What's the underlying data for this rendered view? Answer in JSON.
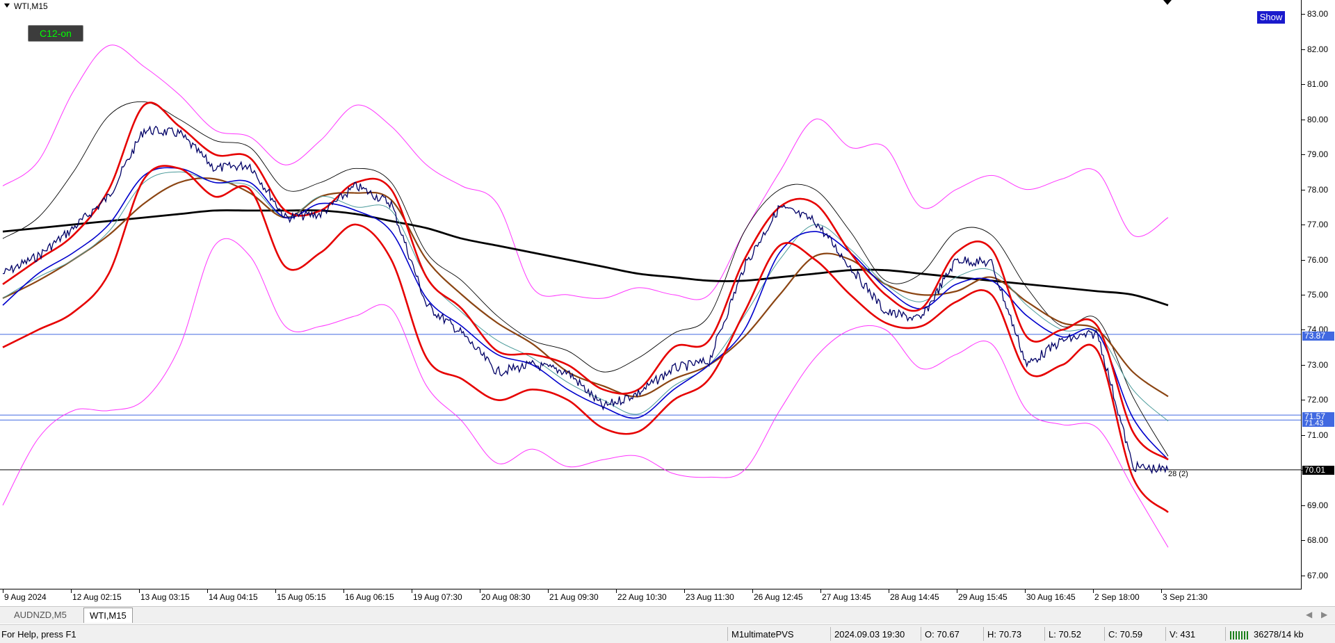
{
  "chart": {
    "title": "WTI,M15",
    "c12_button": "C12-on",
    "show_button": "Show",
    "colors": {
      "background": "#ffffff",
      "price_line": "#000066",
      "band_red": "#e60000",
      "ma_blue": "#0000cc",
      "ma_teal": "#4a9a9a",
      "ma_brown": "#8b4513",
      "ma_black": "#000000",
      "envelope_magenta": "#ff33ff",
      "bollinger_black": "#000000",
      "hline_blue": "#4169e1"
    },
    "level_labels": {
      "l1": "73.87",
      "l2": "71.57",
      "l3": "71.43",
      "current": "70.01"
    },
    "annotation": "28 (2)"
  },
  "chart_data": {
    "type": "line",
    "symbol": "WTI",
    "timeframe": "M15",
    "ylim": [
      66.6,
      83.4
    ],
    "y_ticks": [
      "67.00",
      "68.00",
      "69.00",
      "70.00",
      "71.00",
      "72.00",
      "73.00",
      "74.00",
      "75.00",
      "76.00",
      "77.00",
      "78.00",
      "79.00",
      "80.00",
      "81.00",
      "82.00",
      "83.00"
    ],
    "x_ticks": [
      "9 Aug 2024",
      "12 Aug 02:15",
      "13 Aug 03:15",
      "14 Aug 04:15",
      "15 Aug 05:15",
      "16 Aug 06:15",
      "19 Aug 07:30",
      "20 Aug 08:30",
      "21 Aug 09:30",
      "22 Aug 10:30",
      "23 Aug 11:30",
      "26 Aug 12:45",
      "27 Aug 13:45",
      "28 Aug 14:45",
      "29 Aug 15:45",
      "30 Aug 16:45",
      "2 Sep 18:00",
      "3 Sep 21:30"
    ],
    "horizontal_levels": [
      73.87,
      71.57,
      71.43,
      70.01
    ],
    "series": [
      {
        "values": [
          75.6,
          76.1,
          76.9,
          77.8,
          79.7,
          79.6,
          78.6,
          78.7,
          77.2,
          77.3,
          78.1,
          77.6,
          74.7,
          73.9,
          72.8,
          73.0,
          72.8,
          71.8,
          72.2,
          72.9,
          73.1,
          75.8,
          77.5,
          77.1,
          75.8,
          74.5,
          74.3,
          76.0,
          75.9,
          73.0,
          73.7,
          73.9,
          70.1,
          70.0
        ]
      },
      {
        "values": [
          75.3,
          76.0,
          76.7,
          78.0,
          80.4,
          79.8,
          79.0,
          78.9,
          77.4,
          77.4,
          78.2,
          78.0,
          75.5,
          74.6,
          73.4,
          73.3,
          73.0,
          72.3,
          72.3,
          73.5,
          73.7,
          76.0,
          77.5,
          77.6,
          76.2,
          75.0,
          74.6,
          76.2,
          76.3,
          73.8,
          74.0,
          74.1,
          71.1,
          70.3
        ]
      },
      {
        "values": [
          74.7,
          75.6,
          76.2,
          77.0,
          78.4,
          78.6,
          78.2,
          78.2,
          77.2,
          77.6,
          77.4,
          76.8,
          74.9,
          74.1,
          73.3,
          73.0,
          72.3,
          71.8,
          71.5,
          72.3,
          73.0,
          74.0,
          76.2,
          76.8,
          76.2,
          75.2,
          74.6,
          75.3,
          75.4,
          74.4,
          73.8,
          73.9,
          71.5,
          70.3
        ]
      },
      {
        "values": [
          74.9,
          75.5,
          76.0,
          76.8,
          78.2,
          78.5,
          78.2,
          78.1,
          77.2,
          77.8,
          77.5,
          77.4,
          75.5,
          74.5,
          73.7,
          73.2,
          72.5,
          72.0,
          71.6,
          72.4,
          73.0,
          74.4,
          76.0,
          77.0,
          76.3,
          75.3,
          74.8,
          75.5,
          75.7,
          74.7,
          74.0,
          73.9,
          72.3,
          71.4
        ]
      },
      {
        "values": [
          74.9,
          75.4,
          76.0,
          76.7,
          77.6,
          78.2,
          78.3,
          77.9,
          77.2,
          77.8,
          77.9,
          77.7,
          76.0,
          75.0,
          74.2,
          73.6,
          72.8,
          72.4,
          72.1,
          72.6,
          73.0,
          73.8,
          75.0,
          76.1,
          76.0,
          75.3,
          75.0,
          75.1,
          75.5,
          74.8,
          74.2,
          74.0,
          72.8,
          72.1
        ]
      },
      {
        "values": [
          76.8,
          76.9,
          77.0,
          77.1,
          77.2,
          77.3,
          77.4,
          77.4,
          77.4,
          77.4,
          77.3,
          77.1,
          76.9,
          76.6,
          76.4,
          76.2,
          76.0,
          75.8,
          75.6,
          75.5,
          75.4,
          75.4,
          75.5,
          75.6,
          75.7,
          75.7,
          75.6,
          75.5,
          75.4,
          75.3,
          75.2,
          75.1,
          75.0,
          74.7
        ]
      },
      {
        "values": [
          73.5,
          74.0,
          74.5,
          75.6,
          78.3,
          78.6,
          77.8,
          78.0,
          75.8,
          76.2,
          77.0,
          76.0,
          73.2,
          72.6,
          72.0,
          72.3,
          72.0,
          71.2,
          71.1,
          72.0,
          72.6,
          74.5,
          76.4,
          76.0,
          75.0,
          74.2,
          74.1,
          74.8,
          75.0,
          72.8,
          73.0,
          73.4,
          69.8,
          68.8
        ]
      },
      {
        "values": [
          76.6,
          77.2,
          78.5,
          80.1,
          80.5,
          80.0,
          79.4,
          79.2,
          78.0,
          78.2,
          78.6,
          78.2,
          76.2,
          75.4,
          74.4,
          73.7,
          73.4,
          72.8,
          73.2,
          73.9,
          74.4,
          76.8,
          78.0,
          78.0,
          76.8,
          75.4,
          75.6,
          76.8,
          76.7,
          75.2,
          74.1,
          74.3,
          72.1,
          70.4
        ]
      },
      {
        "values": [
          78.1,
          78.8,
          80.8,
          82.1,
          81.5,
          80.7,
          79.7,
          79.5,
          78.7,
          79.4,
          80.4,
          79.8,
          78.7,
          78.1,
          77.6,
          75.2,
          75.0,
          74.9,
          75.2,
          75.0,
          75.0,
          76.8,
          78.5,
          80.0,
          79.2,
          79.2,
          77.5,
          78.0,
          78.4,
          78.0,
          78.3,
          78.5,
          76.7,
          77.2
        ]
      },
      {
        "values": [
          69.0,
          70.9,
          71.7,
          71.7,
          72.0,
          73.5,
          76.4,
          76.1,
          74.1,
          74.1,
          74.4,
          74.6,
          72.4,
          71.4,
          70.2,
          70.6,
          70.1,
          70.3,
          70.4,
          69.9,
          69.8,
          70.0,
          71.7,
          73.2,
          74.0,
          74.0,
          72.9,
          73.3,
          73.6,
          71.7,
          71.3,
          71.2,
          69.5,
          67.8
        ]
      }
    ]
  },
  "tabs": [
    "AUDNZD,M5",
    "WTI,M15"
  ],
  "status": {
    "help": "For Help, press F1",
    "profile": "M1ultimatePVS",
    "datetime": "2024.09.03 19:30",
    "open": "O: 70.67",
    "high": "H: 70.73",
    "low": "L: 70.52",
    "close": "C: 70.59",
    "volume": "V: 431",
    "traffic": "36278/14 kb"
  }
}
